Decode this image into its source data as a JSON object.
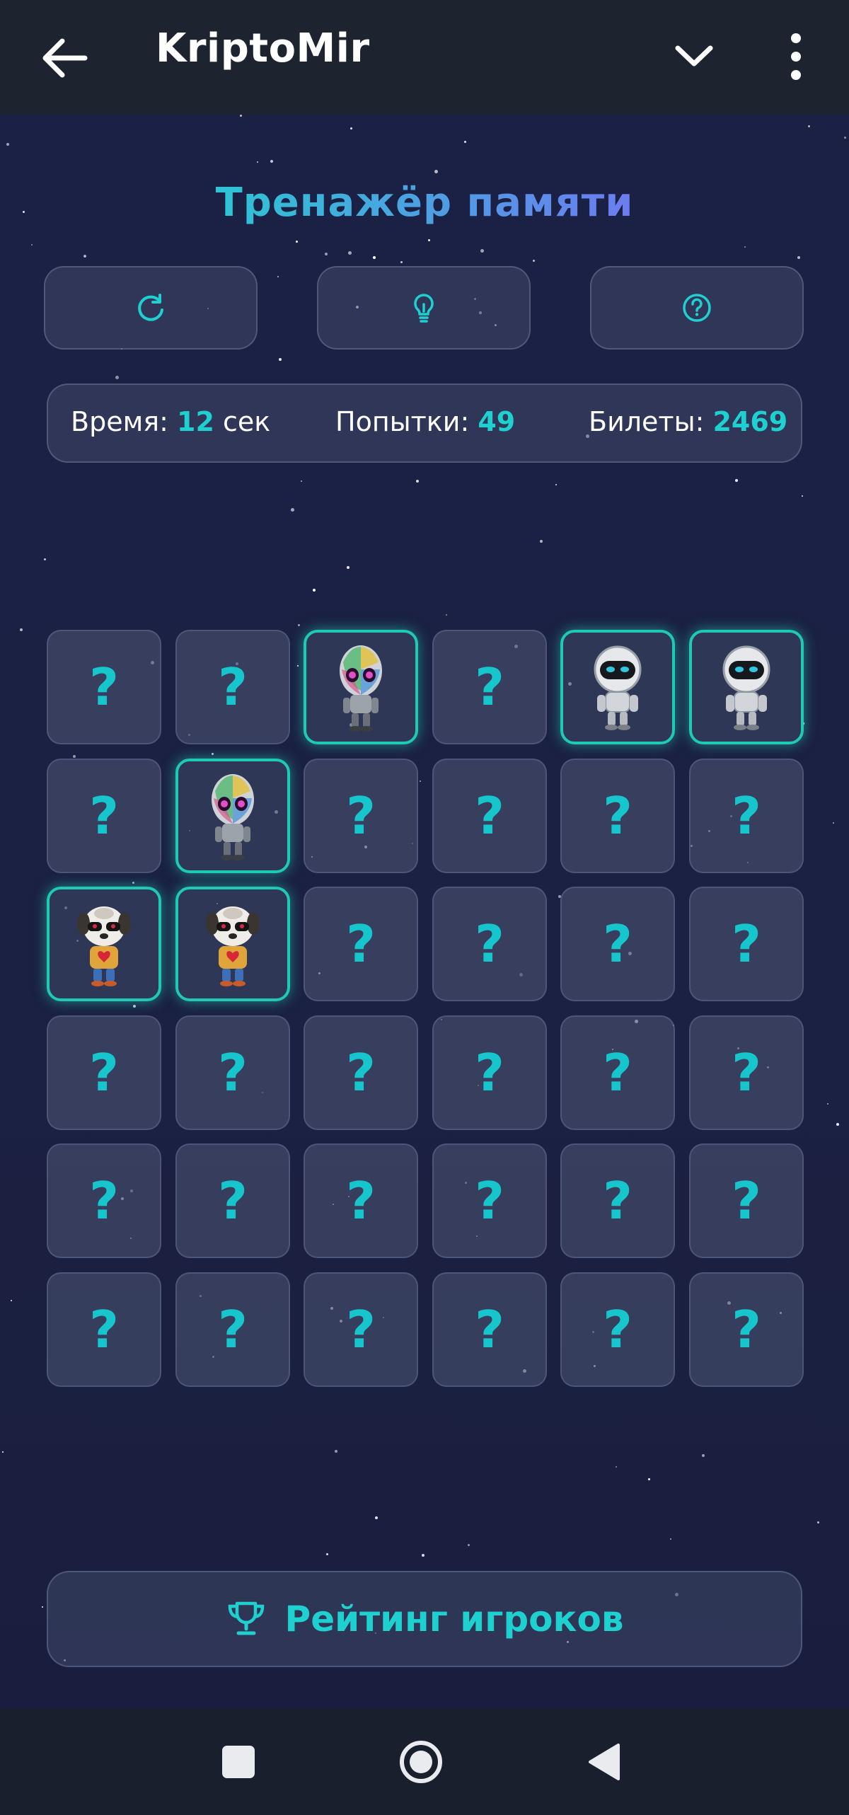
{
  "appbar": {
    "title": "KriptoMir",
    "back_icon": "arrow-left-icon",
    "menu_icon": "chevron-down-icon",
    "more_icon": "more-vertical-icon"
  },
  "game": {
    "title": "Тренажёр памяти",
    "tools": [
      {
        "icon": "refresh-icon"
      },
      {
        "icon": "lightbulb-icon"
      },
      {
        "icon": "help-icon"
      }
    ],
    "stats": {
      "time_label": "Время:",
      "time_value": "12",
      "time_unit": "сек",
      "attempts_label": "Попытки:",
      "attempts_value": "49",
      "tickets_label": "Билеты:",
      "tickets_value": "2469"
    },
    "hidden_symbol": "?",
    "grid": [
      [
        "hidden",
        "hidden",
        "alien",
        "hidden",
        "astronaut",
        "astronaut"
      ],
      [
        "hidden",
        "alien",
        "hidden",
        "hidden",
        "hidden",
        "hidden"
      ],
      [
        "dog",
        "dog",
        "hidden",
        "hidden",
        "hidden",
        "hidden"
      ],
      [
        "hidden",
        "hidden",
        "hidden",
        "hidden",
        "hidden",
        "hidden"
      ],
      [
        "hidden",
        "hidden",
        "hidden",
        "hidden",
        "hidden",
        "hidden"
      ],
      [
        "hidden",
        "hidden",
        "hidden",
        "hidden",
        "hidden",
        "hidden"
      ]
    ],
    "rating_button": {
      "label": "Рейтинг игроков",
      "icon": "trophy-icon"
    }
  },
  "navbar": {
    "items": [
      {
        "icon": "recents-square-icon"
      },
      {
        "icon": "home-circle-icon"
      },
      {
        "icon": "back-triangle-icon"
      }
    ]
  },
  "colors": {
    "accent": "#1fd0d0",
    "matched_border": "#1fc9b4",
    "background": "#1b2145",
    "appbar": "#1d232f"
  }
}
